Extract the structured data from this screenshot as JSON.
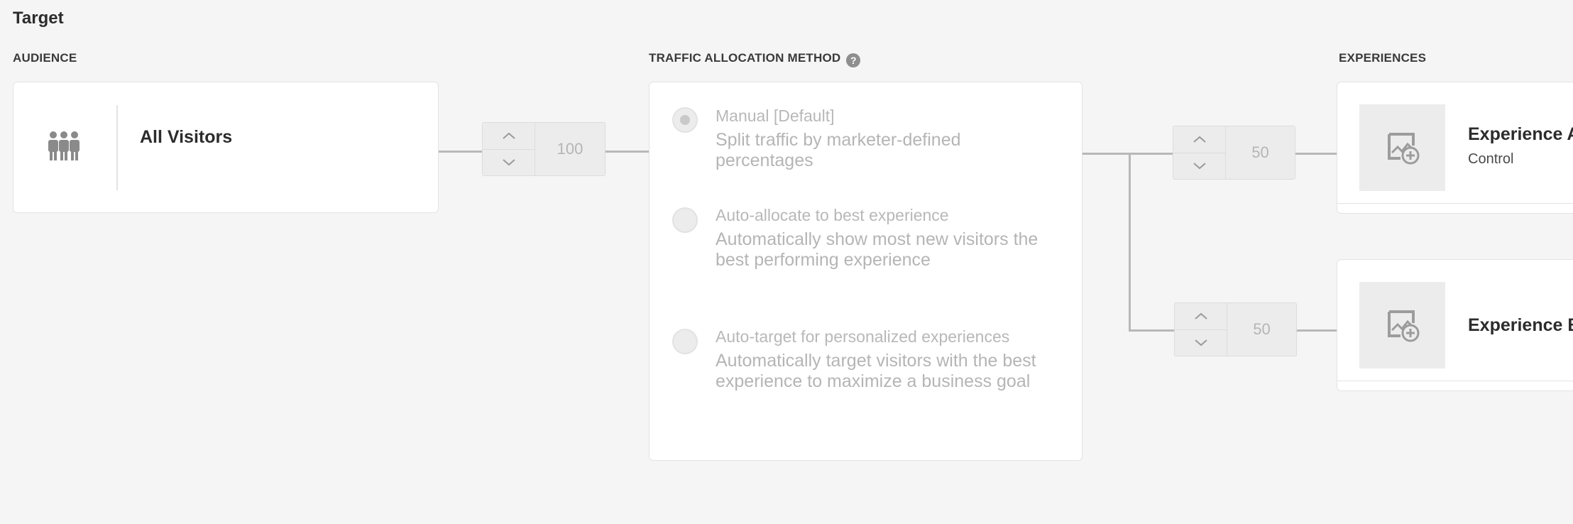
{
  "page": {
    "title": "Target"
  },
  "audience": {
    "section_label": "AUDIENCE",
    "card": {
      "icon": "people-group-icon",
      "name": "All Visitors"
    },
    "allocation": {
      "value": "100"
    }
  },
  "traffic": {
    "section_label": "TRAFFIC ALLOCATION METHOD",
    "help_icon": "question-icon",
    "help_glyph": "?",
    "options": [
      {
        "title": "Manual [Default]",
        "description": "Split traffic by marketer-defined percentages",
        "selected": true
      },
      {
        "title": "Auto-allocate to best experience",
        "description": "Automatically show most new visitors the best performing experience",
        "selected": false
      },
      {
        "title": "Auto-target for personalized experiences",
        "description": "Automatically target visitors with the best experience to maximize a business goal",
        "selected": false
      }
    ]
  },
  "experiences": {
    "section_label": "EXPERIENCES",
    "items": [
      {
        "name": "Experience A",
        "subtitle": "Control",
        "allocation": "50",
        "thumb_icon": "add-image-icon"
      },
      {
        "name": "Experience B",
        "subtitle": "",
        "allocation": "50",
        "thumb_icon": "add-image-icon"
      }
    ]
  },
  "colors": {
    "background": "#f5f5f5",
    "card": "#ffffff",
    "connector": "#b8b8b8",
    "disabled_text": "#b5b5b5"
  }
}
